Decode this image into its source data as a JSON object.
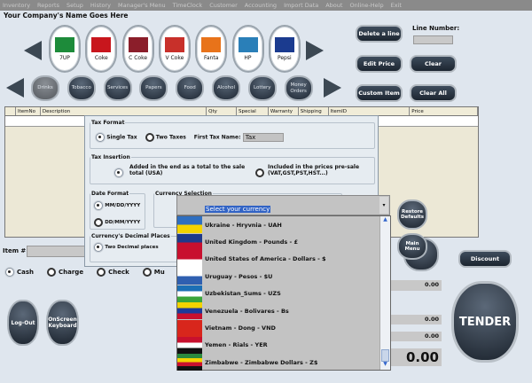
{
  "menu": [
    "Inventory",
    "Reports",
    "Setup",
    "History",
    "Manager's Menu",
    "TimeClock",
    "Customer",
    "Accounting",
    "Import Data",
    "About",
    "Online-Help",
    "Exit"
  ],
  "company_name": "Your Company's Name Goes Here",
  "products": [
    {
      "label": "7UP",
      "color": "#1d8b3a"
    },
    {
      "label": "Coke",
      "color": "#c8161d"
    },
    {
      "label": "C Coke",
      "color": "#8b1e2a"
    },
    {
      "label": "V Coke",
      "color": "#c8302a"
    },
    {
      "label": "Fanta",
      "color": "#e8731a"
    },
    {
      "label": "HP",
      "color": "#2a7fb8"
    },
    {
      "label": "Pepsi",
      "color": "#1b3b8f"
    }
  ],
  "categories": [
    "Drinks",
    "Tobacco",
    "Services",
    "Papers",
    "Food",
    "Alcohol",
    "Lottery",
    "Money Orders"
  ],
  "right_buttons": {
    "delete_line": "Delete a line",
    "edit_price": "Edit Price",
    "custom_item": "Custom Item",
    "clear": "Clear",
    "clear_all": "Clear All",
    "line_number_label": "Line Number:"
  },
  "table_columns": [
    "",
    "ItemNo",
    "Description",
    "Qty",
    "Special Order",
    "Warranty",
    "Shipping",
    "ItemID",
    "Price"
  ],
  "dialog": {
    "tax_format": {
      "title": "Tax Format",
      "single": "Single Tax",
      "two": "Two Taxes",
      "first_tax_label": "First Tax Name:",
      "first_tax_value": "Tax"
    },
    "tax_insertion": {
      "title": "Tax Insertion",
      "added": "Added in the end as a total to the sale total (USA)",
      "included": "Included in the prices pre-sale (VAT,GST,PST,HST...)"
    },
    "date_format": {
      "title": "Date Format",
      "mdy": "MM/DD/YYYY",
      "dmy": "DD/MM/YYYY"
    },
    "decimal": {
      "title": "Currency's Decimal Places",
      "two": "Two Decimal places"
    },
    "currency": {
      "title": "Currency Selection",
      "value": "Select your currency"
    },
    "restore_defaults": "Restore Defaults",
    "main_menu": "Main Menu"
  },
  "currency_options": [
    "Ukraine - Hryvnia - UAH",
    "United Kingdom - Pounds - £",
    "United States of America - Dollars - $",
    "Uruguay - Pesos - $U",
    "Uzbekistan_Sums - UZS",
    "Venezuela - Bolivares - Bs",
    "Vietnam - Dong - VND",
    "Yemen - Rials - YER",
    "Zimbabwe - Zimbabwe Dollars - Z$"
  ],
  "item_label": "Item #",
  "payment": [
    "Cash",
    "Charge",
    "Check",
    "Mu"
  ],
  "bottom": {
    "logout": "Log-Out",
    "keyboard": "OnScreen Keyboard",
    "discount": "Discount",
    "tender": "TENDER"
  },
  "amounts": [
    "0.00",
    "0.00",
    "0.00",
    "0.00"
  ]
}
